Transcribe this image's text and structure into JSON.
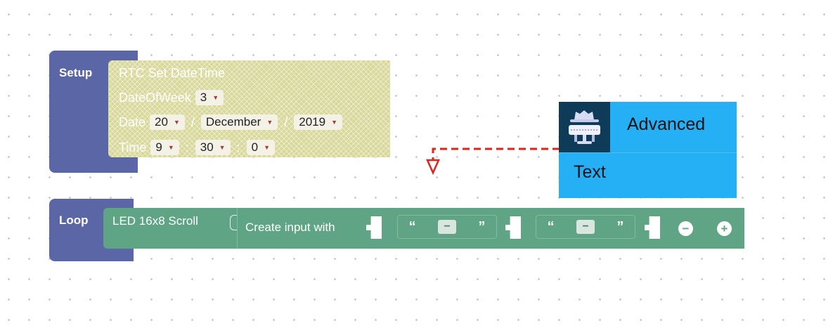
{
  "setup": {
    "label": "Setup",
    "rtc": {
      "title": "RTC Set DateTime",
      "dow_label": "DateOfWeek",
      "dow_value": "3",
      "date_label": "Date",
      "day": "20",
      "month": "December",
      "year": "2019",
      "date_sep": "/",
      "time_label": "Time",
      "hour": "9",
      "minute": "30",
      "second": "0",
      "time_sep": ":"
    }
  },
  "loop": {
    "label": "Loop",
    "led_block": "LED 16x8 Scroll",
    "create_input": "Create input with",
    "quote_open": "“",
    "quote_close": "”",
    "minus_symbol": "−",
    "remove_symbol": "−",
    "add_symbol": "+"
  },
  "menu": {
    "items": [
      {
        "label": "Advanced",
        "icon": "incognito-agent-icon"
      },
      {
        "label": "Text"
      }
    ]
  },
  "colors": {
    "hat_block": "#5b66a6",
    "rtc_block": "#d8d89a",
    "led_block": "#5ea485",
    "menu_bg": "#25b0f5",
    "menu_icon_bg": "#0e3b57",
    "drag_arrow": "#e3231b"
  }
}
